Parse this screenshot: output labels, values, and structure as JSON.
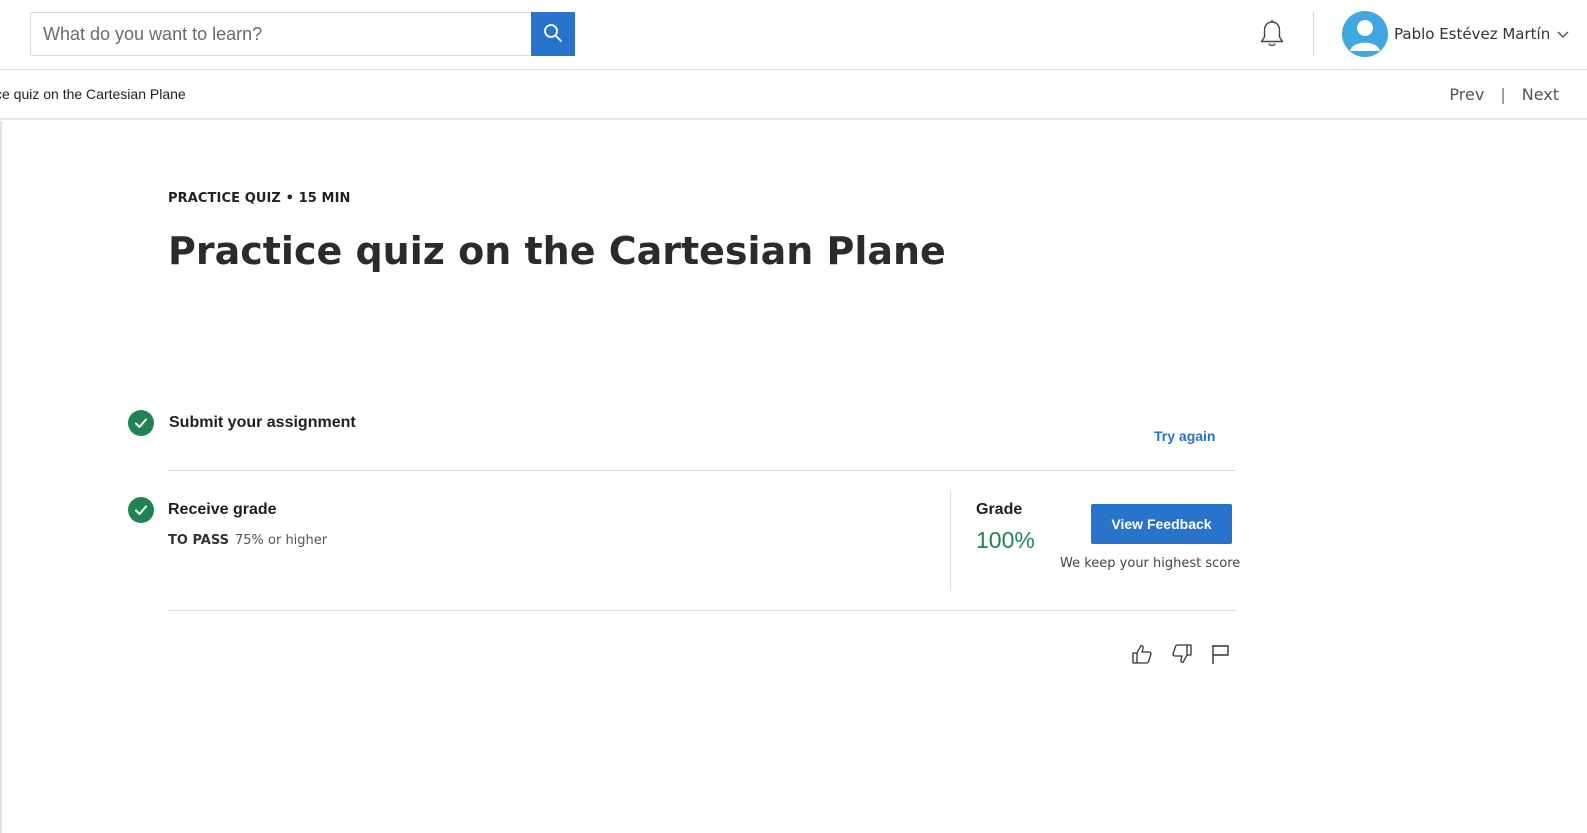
{
  "header": {
    "search": {
      "placeholder": "What do you want to learn?",
      "value": "",
      "button_icon": "search-icon"
    },
    "notifications_icon": "bell-icon",
    "user": {
      "name": "Pablo Estévez Martín",
      "avatar_icon": "user-avatar-icon",
      "menu_icon": "chevron-down-icon"
    }
  },
  "subheader": {
    "breadcrumb": "ce quiz on the Cartesian Plane",
    "prev_label": "Prev",
    "separator": "|",
    "next_label": "Next"
  },
  "quiz": {
    "kicker": "PRACTICE QUIZ • 15 MIN",
    "title": "Practice quiz on the Cartesian Plane",
    "steps": [
      {
        "title": "Submit your assignment",
        "status": "complete",
        "action_label": "Try again"
      },
      {
        "title": "Receive grade",
        "status": "complete",
        "pass_label": "TO PASS",
        "pass_value": "75% or higher",
        "grade_label": "Grade",
        "grade_value": "100%",
        "feedback_button": "View Feedback",
        "note": "We keep your highest score"
      }
    ],
    "feedback_icons": [
      "thumbs-up-icon",
      "thumbs-down-icon",
      "flag-icon"
    ]
  },
  "colors": {
    "accent": "#2a73cc",
    "success": "#1f8354",
    "avatar": "#3fa8e0"
  }
}
